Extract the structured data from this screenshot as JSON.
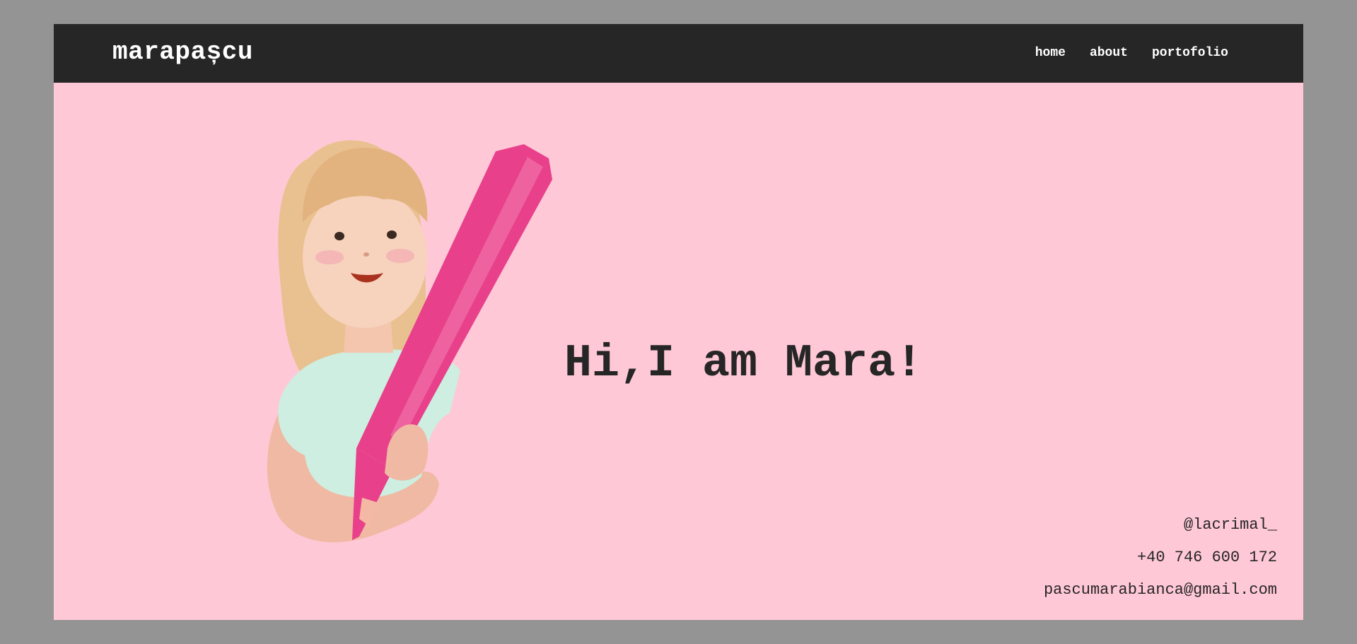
{
  "header": {
    "brand": "marapașcu",
    "nav": [
      {
        "label": "home"
      },
      {
        "label": "about"
      },
      {
        "label": "portofolio"
      }
    ]
  },
  "hero": {
    "heading": "Hi,I am Mara!",
    "illustration": "girl-holding-pink-pencil-illustration"
  },
  "contact": {
    "instagram": "@lacrimal_",
    "phone": "+40 746 600 172",
    "email": "pascumarabianca@gmail.com"
  },
  "colors": {
    "page_background": "#949494",
    "navbar": "#262626",
    "hero_background": "#ffc8d6",
    "pencil": "#e8408a",
    "text_dark": "#262626"
  }
}
